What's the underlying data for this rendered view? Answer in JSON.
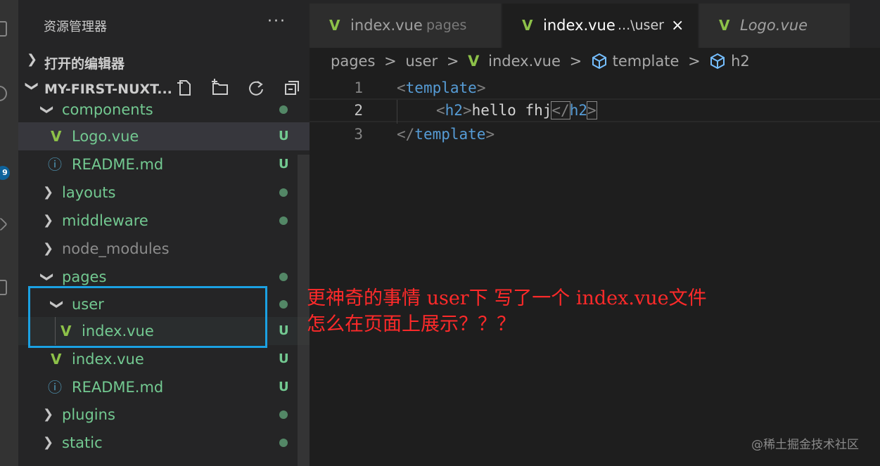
{
  "sidebar": {
    "title": "资源管理器",
    "more": "···",
    "open_editors": "打开的编辑器",
    "project": "MY-FIRST-NUXT...",
    "tree": [
      {
        "name": "components",
        "type": "folder",
        "expanded": true,
        "status": "dot"
      },
      {
        "name": "Logo.vue",
        "type": "vue",
        "status": "U"
      },
      {
        "name": "README.md",
        "type": "info",
        "status": "U"
      },
      {
        "name": "layouts",
        "type": "folder",
        "expanded": false,
        "status": "dot"
      },
      {
        "name": "middleware",
        "type": "folder",
        "expanded": false,
        "status": "dot"
      },
      {
        "name": "node_modules",
        "type": "folder",
        "expanded": false,
        "status": ""
      },
      {
        "name": "pages",
        "type": "folder",
        "expanded": true,
        "status": "dot"
      },
      {
        "name": "user",
        "type": "folder",
        "expanded": true,
        "status": "dot"
      },
      {
        "name": "index.vue",
        "type": "vue",
        "status": "U"
      },
      {
        "name": "index.vue",
        "type": "vue",
        "status": "U"
      },
      {
        "name": "README.md",
        "type": "info",
        "status": "U"
      },
      {
        "name": "plugins",
        "type": "folder",
        "expanded": false,
        "status": "dot"
      },
      {
        "name": "static",
        "type": "folder",
        "expanded": false,
        "status": "dot"
      }
    ]
  },
  "activity": {
    "badge": "9"
  },
  "tabs": [
    {
      "label": "index.vue",
      "desc": "pages",
      "active": false
    },
    {
      "label": "index.vue",
      "desc": "...\\user",
      "active": true,
      "close": "×"
    },
    {
      "label": "Logo.vue",
      "desc": "",
      "active": false
    }
  ],
  "breadcrumb": {
    "p1": "pages",
    "p2": "user",
    "p3": "index.vue",
    "p4": "template",
    "p5": "h2",
    "sep": ">"
  },
  "code": {
    "lines": [
      "1",
      "2",
      "3"
    ],
    "l1_open": "<",
    "l1_tag": "template",
    "l1_close": ">",
    "l2_open": "<",
    "l2_tag": "h2",
    "l2_close": ">",
    "l2_text": "hello fhj",
    "l2_end_open": "</",
    "l2_end_tag": "h2",
    "l2_end_close": ">",
    "l3_open": "</",
    "l3_tag": "template",
    "l3_close": ">"
  },
  "annotation": {
    "line1": "更神奇的事情 user下 写了一个 index.vue文件",
    "line2": "怎么在页面上展示？？？"
  },
  "watermark": "@稀土掘金技术社区",
  "colors": {
    "vue": "#8dc149",
    "untracked": "#73c991",
    "tag": "#569cd6",
    "highlight_box": "#1ba1e2",
    "annotation": "#ff2a2a"
  }
}
